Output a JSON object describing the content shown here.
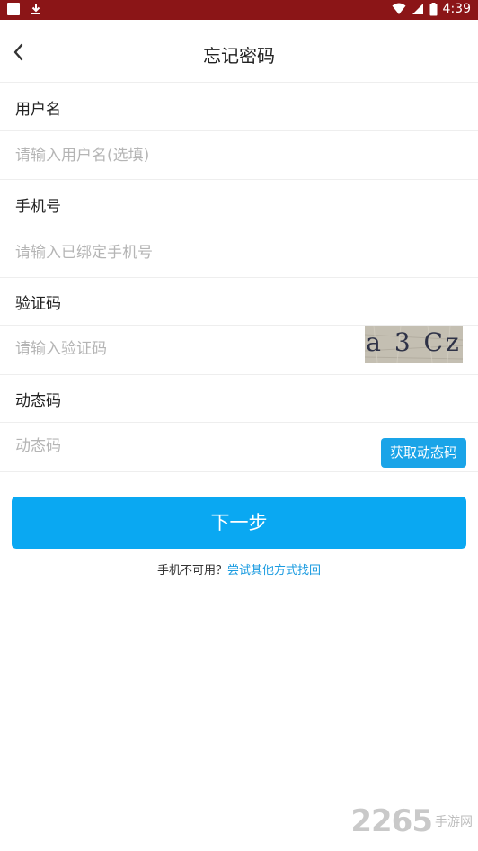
{
  "status_bar": {
    "time": "4:39",
    "icons": [
      "app-square-icon",
      "download-icon",
      "wifi-icon",
      "signal-icon",
      "battery-icon"
    ],
    "background": "#8b1517"
  },
  "header": {
    "title": "忘记密码",
    "back_icon": "chevron-left-icon"
  },
  "form": {
    "username": {
      "label": "用户名",
      "placeholder": "请输入用户名(选填)"
    },
    "phone": {
      "label": "手机号",
      "placeholder": "请输入已绑定手机号"
    },
    "captcha": {
      "label": "验证码",
      "placeholder": "请输入验证码",
      "image_text": "a 3 Cz"
    },
    "sms_code": {
      "label": "动态码",
      "placeholder": "动态码",
      "button_label": "获取动态码"
    }
  },
  "actions": {
    "next_label": "下一步",
    "alt_prefix": "手机不可用？",
    "alt_link": "尝试其他方式找回"
  },
  "watermark": {
    "number": "2265",
    "text": "手游网"
  },
  "colors": {
    "accent": "#0aa8f2",
    "link": "#1a9be0",
    "placeholder": "#b5b5b5",
    "divider": "#eeeeee"
  }
}
